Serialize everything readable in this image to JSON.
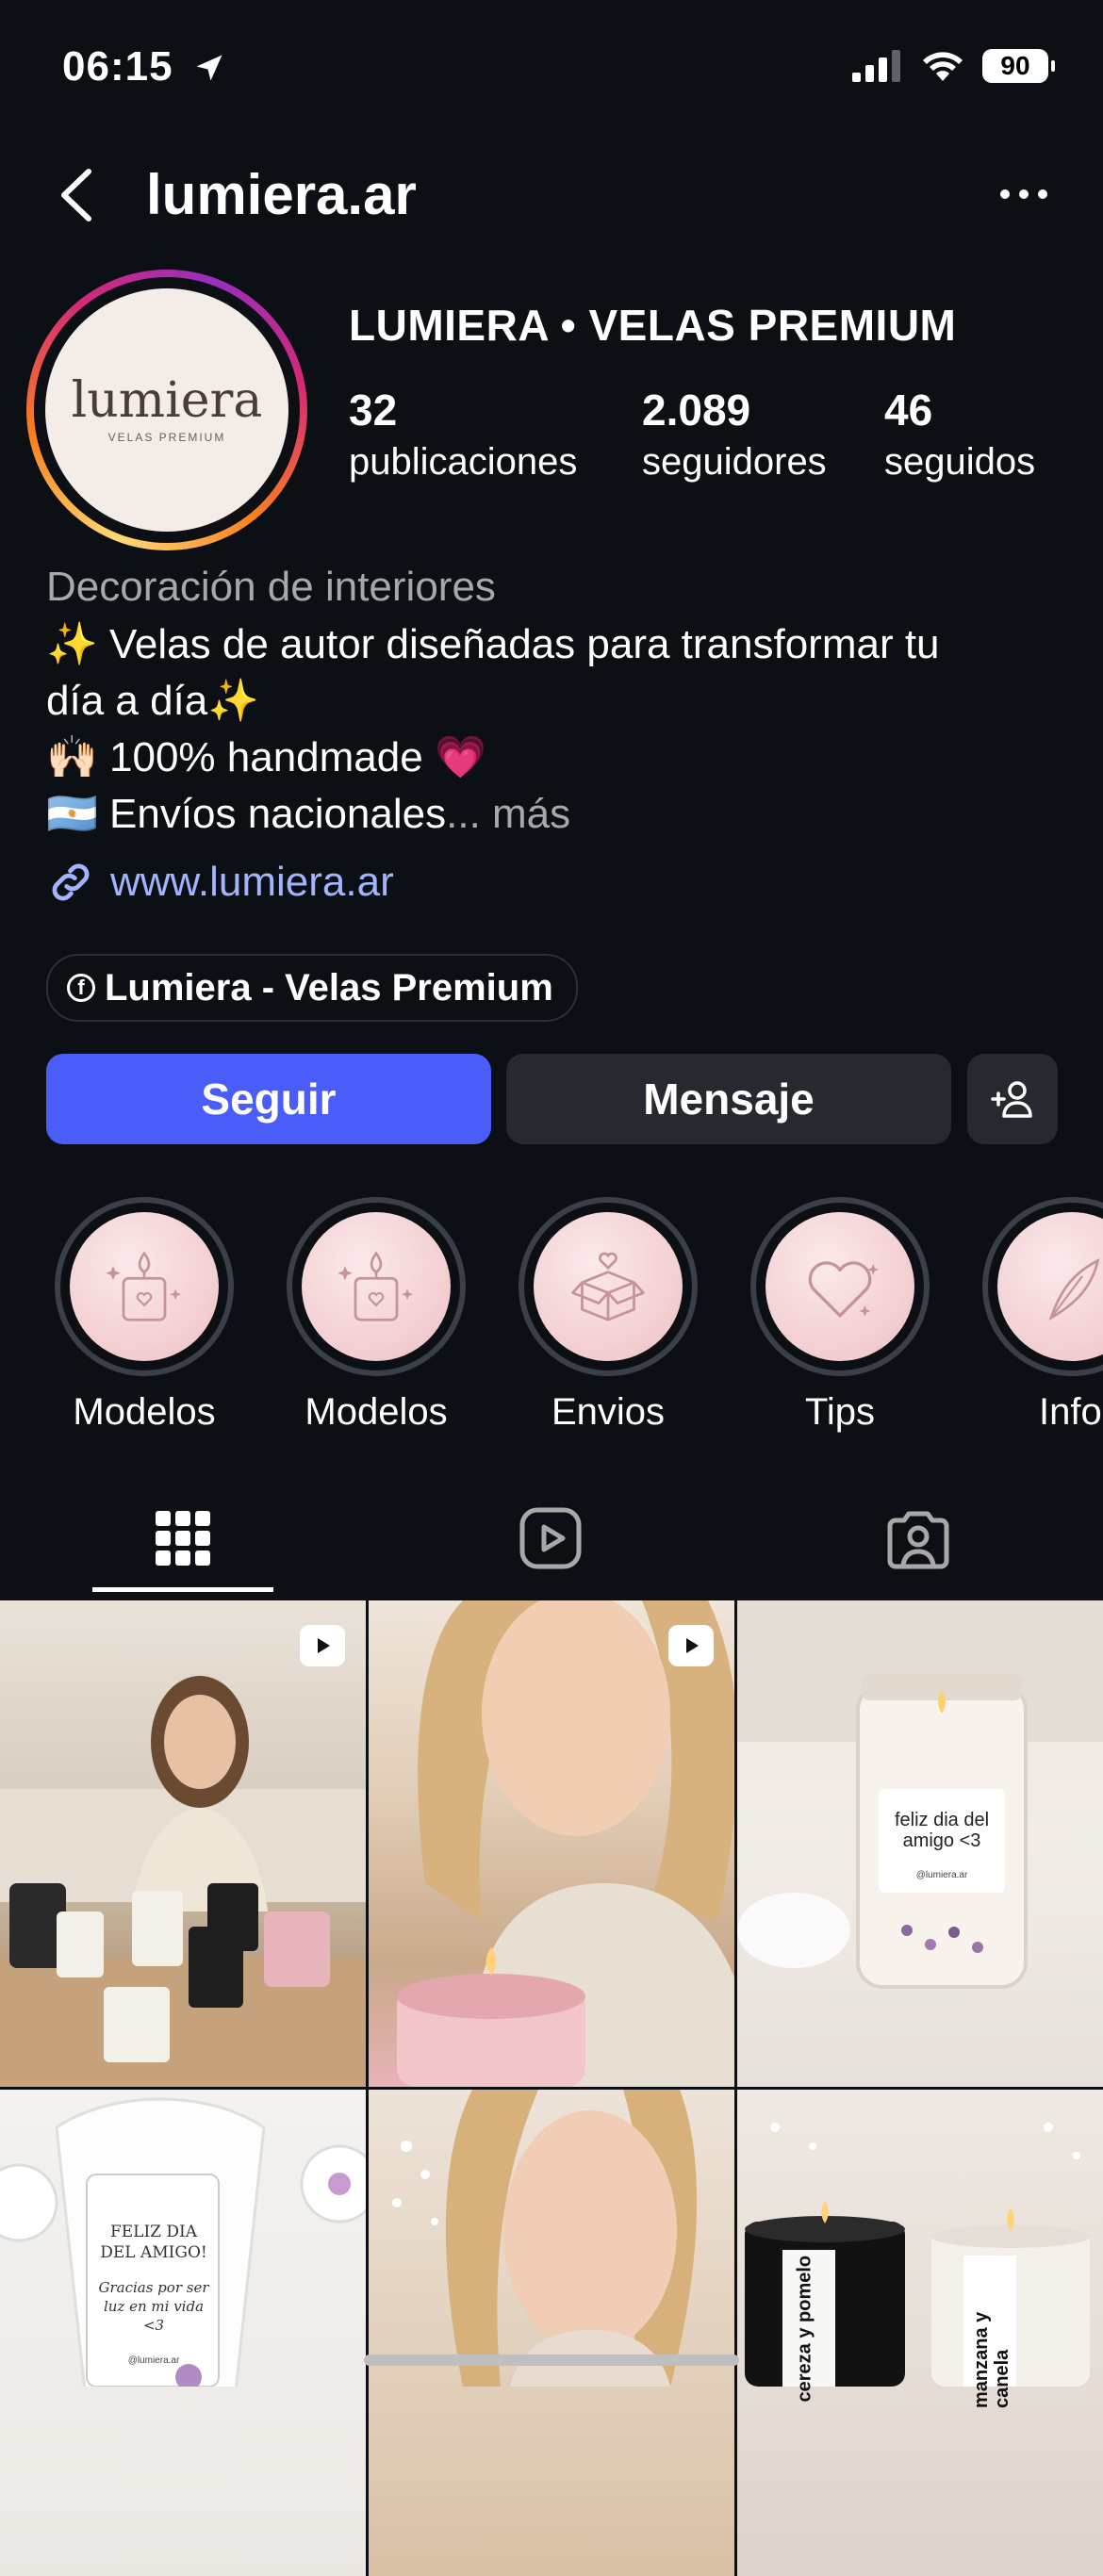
{
  "status_bar": {
    "time": "06:15",
    "battery": "90"
  },
  "header": {
    "username": "lumiera.ar"
  },
  "profile": {
    "avatar": {
      "logo": "lumiera",
      "tagline": "VELAS PREMIUM"
    },
    "display_name": "LUMIERA • VELAS PREMIUM",
    "stats": [
      {
        "value": "32",
        "label": "publicaciones"
      },
      {
        "value": "2.089",
        "label": "seguidores"
      },
      {
        "value": "46",
        "label": "seguidos"
      }
    ],
    "category": "Decoración de interiores",
    "bio": {
      "line1": "✨ Velas de autor diseñadas para transformar tu",
      "line2": "día a día✨",
      "line3": "🙌🏻 100% handmade 💗",
      "line4": "🇦🇷 Envíos nacionales",
      "more": "... más"
    },
    "link": "www.lumiera.ar",
    "facebook_chip": "Lumiera - Velas Premium"
  },
  "actions": {
    "follow": "Seguir",
    "message": "Mensaje"
  },
  "highlights": [
    {
      "label": "Modelos",
      "icon": "candle-icon"
    },
    {
      "label": "Modelos",
      "icon": "candle-icon"
    },
    {
      "label": "Envios",
      "icon": "box-icon"
    },
    {
      "label": "Tips",
      "icon": "heart-icon"
    },
    {
      "label": "Info",
      "icon": "leaf-icon"
    }
  ],
  "tabs": [
    {
      "name": "grid",
      "icon": "grid-icon",
      "active": true
    },
    {
      "name": "reels",
      "icon": "reels-icon",
      "active": false
    },
    {
      "name": "tagged",
      "icon": "tagged-icon",
      "active": false
    }
  ],
  "posts": [
    {
      "type": "reel"
    },
    {
      "type": "reel"
    },
    {
      "type": "photo",
      "jar_label": "feliz dia del amigo <3",
      "brand": "@lumiera.ar"
    },
    {
      "type": "photo",
      "tag_title": "FELIZ DIA DEL AMIGO!",
      "tag_text": "Gracias por ser luz en mi vida <3",
      "brand": "@lumiera.ar"
    },
    {
      "type": "photo"
    },
    {
      "type": "photo",
      "label_left": "cereza y pomelo",
      "label_right": "manzana y canela"
    }
  ]
}
